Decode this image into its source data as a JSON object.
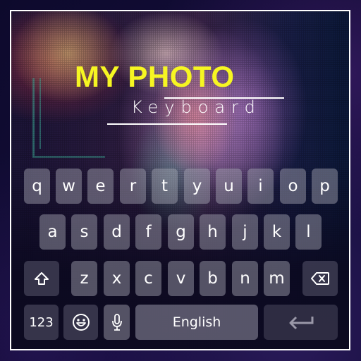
{
  "title": {
    "main": "MY PHOTO",
    "sub": "Keyboard"
  },
  "keyboard": {
    "rows": [
      [
        "q",
        "w",
        "e",
        "r",
        "t",
        "y",
        "u",
        "i",
        "o",
        "p"
      ],
      [
        "a",
        "s",
        "d",
        "f",
        "g",
        "h",
        "j",
        "k",
        "l"
      ],
      [
        "z",
        "x",
        "c",
        "v",
        "b",
        "n",
        "m"
      ]
    ],
    "shift_icon": "shift-arrow-icon",
    "backspace_icon": "backspace-icon",
    "numbers_label": "123",
    "emoji_icon": "smiley-emoji-icon",
    "mic_icon": "microphone-icon",
    "space_label": "English",
    "enter_icon": "enter-return-icon"
  },
  "colors": {
    "title_accent": "#f6f622",
    "subtitle": "#ffffff",
    "frame": "#ffffff"
  }
}
